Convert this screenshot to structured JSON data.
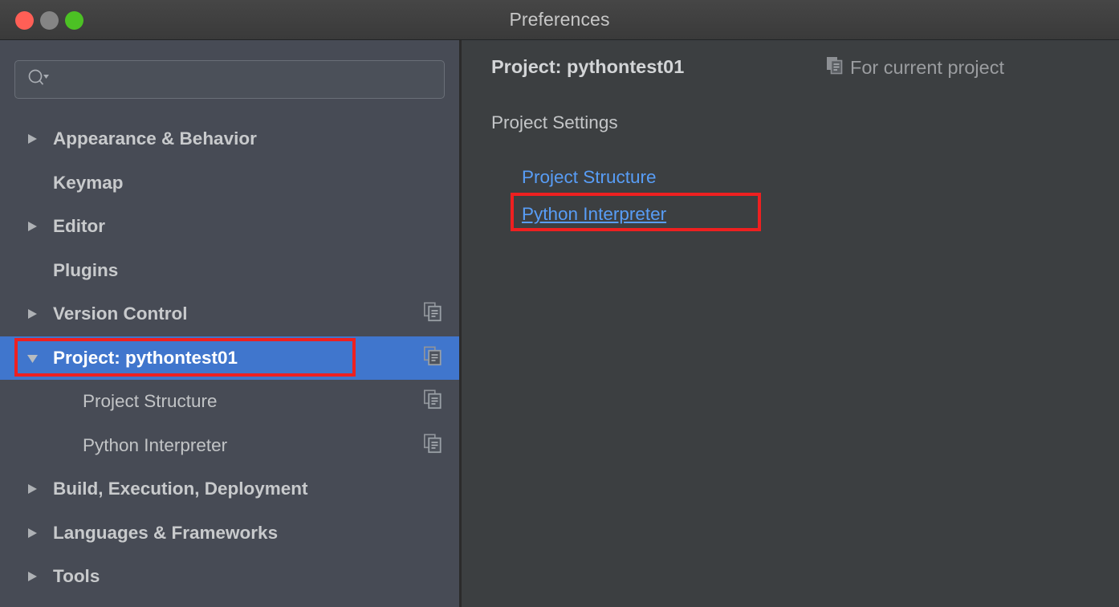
{
  "window": {
    "title": "Preferences",
    "traffic_lights": [
      {
        "name": "close-button",
        "color": "#ff5f56"
      },
      {
        "name": "minimize-button",
        "color": "#858585"
      },
      {
        "name": "zoom-button",
        "color": "#4cc124"
      }
    ]
  },
  "search": {
    "value": "",
    "placeholder": "",
    "icon": "search-icon",
    "dropdown_icon": "chevron-down-icon"
  },
  "sidebar": {
    "background": "#474b55",
    "selection_color": "#4076cd",
    "items": [
      {
        "label": "Appearance & Behavior",
        "level": 0,
        "arrow": "collapsed",
        "copy_icon": false,
        "selected": false
      },
      {
        "label": "Keymap",
        "level": 0,
        "arrow": "none",
        "copy_icon": false,
        "selected": false
      },
      {
        "label": "Editor",
        "level": 0,
        "arrow": "collapsed",
        "copy_icon": false,
        "selected": false
      },
      {
        "label": "Plugins",
        "level": 0,
        "arrow": "none",
        "copy_icon": false,
        "selected": false
      },
      {
        "label": "Version Control",
        "level": 0,
        "arrow": "collapsed",
        "copy_icon": true,
        "selected": false
      },
      {
        "label": "Project: pythontest01",
        "level": 0,
        "arrow": "expanded",
        "copy_icon": true,
        "selected": true
      },
      {
        "label": "Project Structure",
        "level": 1,
        "arrow": "none",
        "copy_icon": true,
        "selected": false
      },
      {
        "label": "Python Interpreter",
        "level": 1,
        "arrow": "none",
        "copy_icon": true,
        "selected": false
      },
      {
        "label": "Build, Execution, Deployment",
        "level": 0,
        "arrow": "collapsed",
        "copy_icon": false,
        "selected": false
      },
      {
        "label": "Languages & Frameworks",
        "level": 0,
        "arrow": "collapsed",
        "copy_icon": false,
        "selected": false
      },
      {
        "label": "Tools",
        "level": 0,
        "arrow": "collapsed",
        "copy_icon": false,
        "selected": false
      }
    ]
  },
  "main": {
    "title": "Project: pythontest01",
    "scope": {
      "label": "For current project",
      "icon": "copy-icon"
    },
    "section_title": "Project Settings",
    "links": [
      {
        "label": "Project Structure",
        "hovered": false
      },
      {
        "label": "Python Interpreter",
        "hovered": true
      }
    ],
    "link_color": "#589df6"
  },
  "annotations": {
    "color": "#ee2020",
    "boxes": [
      {
        "name": "annotation-sidebar-project-item",
        "target": "Project: pythontest01"
      },
      {
        "name": "annotation-python-interpreter-link",
        "target": "Python Interpreter"
      }
    ]
  }
}
